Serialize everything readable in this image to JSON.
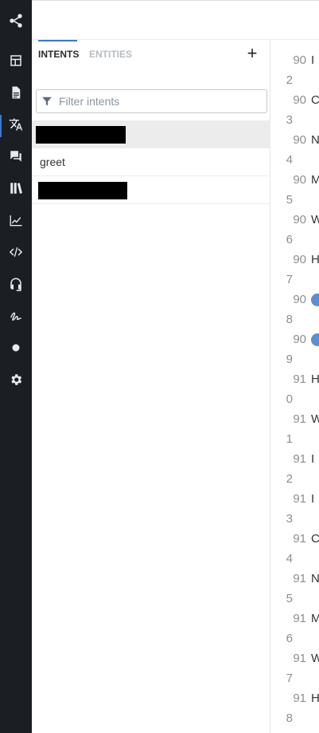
{
  "sidebar": {
    "logo_icon": "share-nodes-icon",
    "items": [
      {
        "icon": "dashboard-icon"
      },
      {
        "icon": "document-icon"
      },
      {
        "icon": "translate-icon",
        "active": true
      },
      {
        "icon": "chat-bubbles-icon"
      },
      {
        "icon": "library-icon"
      },
      {
        "icon": "analytics-chart-icon"
      },
      {
        "icon": "code-icon"
      },
      {
        "icon": "headset-icon"
      },
      {
        "icon": "signature-icon"
      },
      {
        "icon": "dot-icon"
      },
      {
        "icon": "gear-icon"
      }
    ],
    "accent_color": "#3e78c6"
  },
  "panel": {
    "tabs": [
      {
        "label": "INTENTS",
        "active": true
      },
      {
        "label": "ENTITIES",
        "active": false
      }
    ],
    "add_label": "+",
    "filter": {
      "placeholder": "Filter intents",
      "value": ""
    },
    "intents": [
      {
        "label": "",
        "redacted": true,
        "selected": true
      },
      {
        "label": "greet",
        "redacted": false,
        "selected": false
      },
      {
        "label": "",
        "redacted": true,
        "selected": false
      }
    ]
  },
  "gutter": {
    "rows": [
      {
        "n1": "90",
        "n2": "2",
        "letter": "I"
      },
      {
        "n1": "90",
        "n2": "3",
        "letter": "C"
      },
      {
        "n1": "90",
        "n2": "4",
        "letter": "N"
      },
      {
        "n1": "90",
        "n2": "5",
        "letter": "M"
      },
      {
        "n1": "90",
        "n2": "6",
        "letter": "W"
      },
      {
        "n1": "90",
        "n2": "7",
        "letter": "H"
      },
      {
        "n1": "90",
        "n2": "8",
        "letter": "",
        "dot": true
      },
      {
        "n1": "90",
        "n2": "9",
        "letter": "",
        "dot": true
      },
      {
        "n1": "91",
        "n2": "0",
        "letter": "H"
      },
      {
        "n1": "91",
        "n2": "1",
        "letter": "W"
      },
      {
        "n1": "91",
        "n2": "2",
        "letter": "I"
      },
      {
        "n1": "91",
        "n2": "3",
        "letter": "I"
      },
      {
        "n1": "91",
        "n2": "4",
        "letter": "C"
      },
      {
        "n1": "91",
        "n2": "5",
        "letter": "N"
      },
      {
        "n1": "91",
        "n2": "6",
        "letter": "M"
      },
      {
        "n1": "91",
        "n2": "7",
        "letter": "W"
      },
      {
        "n1": "91",
        "n2": "8",
        "letter": "H"
      }
    ],
    "dot_color": "#5b8fd0"
  }
}
